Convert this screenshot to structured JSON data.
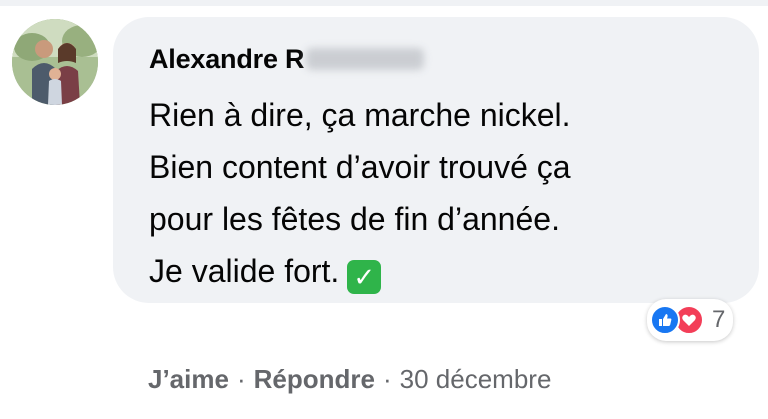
{
  "comment": {
    "author": "Alexandre R",
    "lines": [
      "Rien à dire, ça marche nickel.",
      "Bien content d’avoir trouvé ça",
      "pour les fêtes de fin d’année.",
      "Je valide fort."
    ],
    "emoji": "✓"
  },
  "reactions": {
    "types": [
      "like-icon",
      "love-icon"
    ],
    "count": "7",
    "like_color": "#1877f2",
    "love_color": "#f33e58"
  },
  "actions": {
    "like_label": "J’aime",
    "reply_label": "Répondre",
    "separator": "·",
    "timestamp": "30 décembre"
  }
}
